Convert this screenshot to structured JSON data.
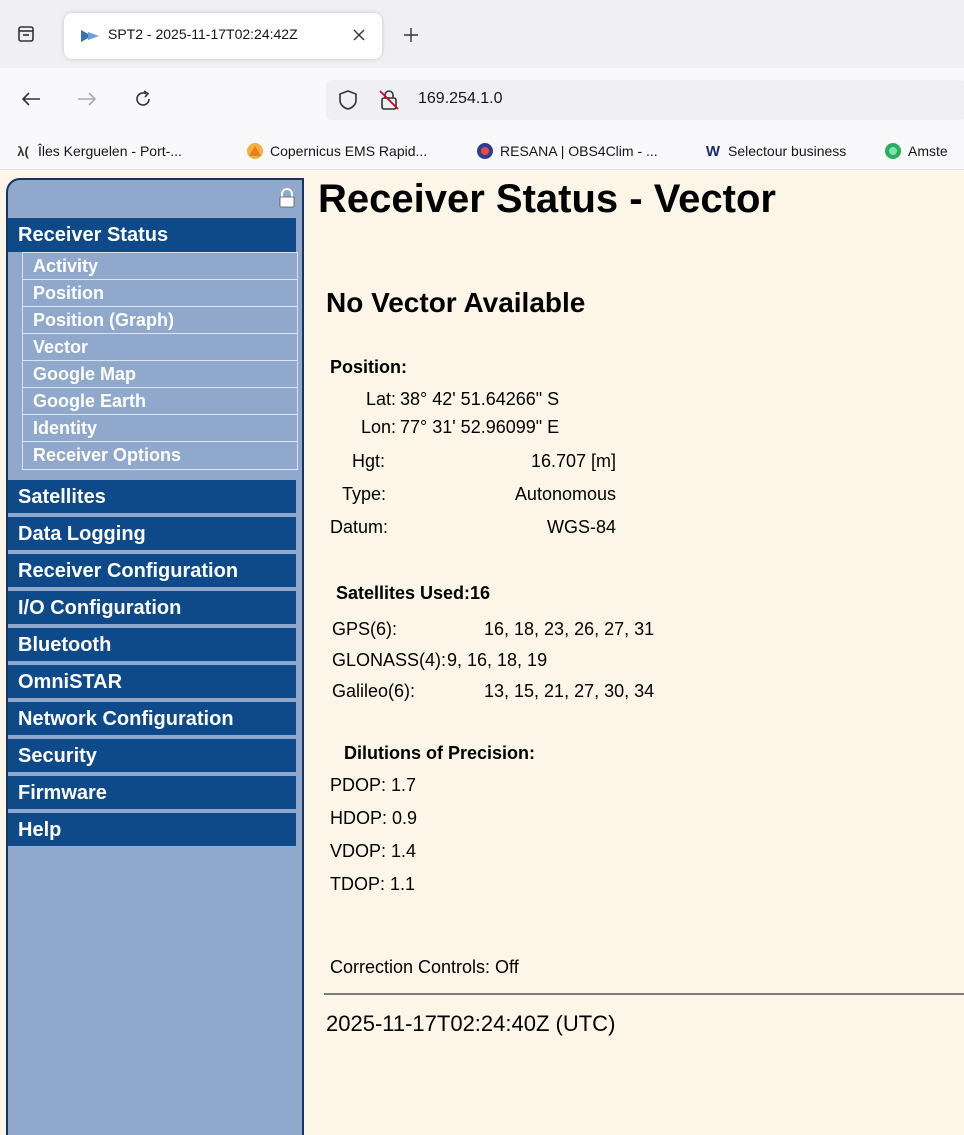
{
  "browser": {
    "tab_title": "SPT2 - 2025-11-17T02:24:42Z",
    "url": "169.254.1.0",
    "bookmarks": [
      {
        "label": "Îles Kerguelen - Port-...",
        "icon": "ys-icon",
        "icon_text": "λ("
      },
      {
        "label": "Copernicus EMS Rapid...",
        "icon": "copernicus-icon"
      },
      {
        "label": "RESANA | OBS4Clim - ...",
        "icon": "resana-icon"
      },
      {
        "label": "Selectour business",
        "icon": "selectour-icon",
        "icon_text": "W"
      },
      {
        "label": "Amste",
        "icon": "amsterdam-icon"
      }
    ]
  },
  "sidebar": {
    "active": "Receiver Status",
    "subitems": [
      "Activity",
      "Position",
      "Position (Graph)",
      "Vector",
      "Google Map",
      "Google Earth",
      "Identity",
      "Receiver Options"
    ],
    "items": [
      "Satellites",
      "Data Logging",
      "Receiver Configuration",
      "I/O Configuration",
      "Bluetooth",
      "OmniSTAR",
      "Network Configuration",
      "Security",
      "Firmware",
      "Help"
    ]
  },
  "main": {
    "title": "Receiver Status - Vector",
    "vector_status": "No Vector Available",
    "position": {
      "label": "Position:",
      "lat_label": "Lat:",
      "lat_value": "38° 42' 51.64266\" S",
      "lon_label": "Lon:",
      "lon_value": "77° 31' 52.96099\" E",
      "hgt_label": "Hgt:",
      "hgt_value": "16.707 [m]",
      "type_label": "Type:",
      "type_value": "Autonomous",
      "datum_label": "Datum:",
      "datum_value": "WGS-84"
    },
    "satellites": {
      "label": "Satellites Used:16",
      "gps_label": "GPS(6):",
      "gps_value": "16, 18, 23, 26, 27, 31",
      "glonass_label": "GLONASS(4):",
      "glonass_value": "9, 16, 18, 19",
      "galileo_label": "Galileo(6):",
      "galileo_value": "13, 15, 21, 27, 30, 34"
    },
    "dop": {
      "label": "Dilutions of Precision:",
      "pdop": "PDOP: 1.7",
      "hdop": "HDOP: 0.9",
      "vdop": "VDOP: 1.4",
      "tdop": "TDOP: 1.1"
    },
    "correction_controls": "Correction Controls: Off",
    "timestamp": "2025-11-17T02:24:40Z (UTC)"
  },
  "colors": {
    "menu_bg": "#0e4a8a",
    "sidebar_bg": "#8fa8cc",
    "page_bg": "#fdf6e8"
  }
}
